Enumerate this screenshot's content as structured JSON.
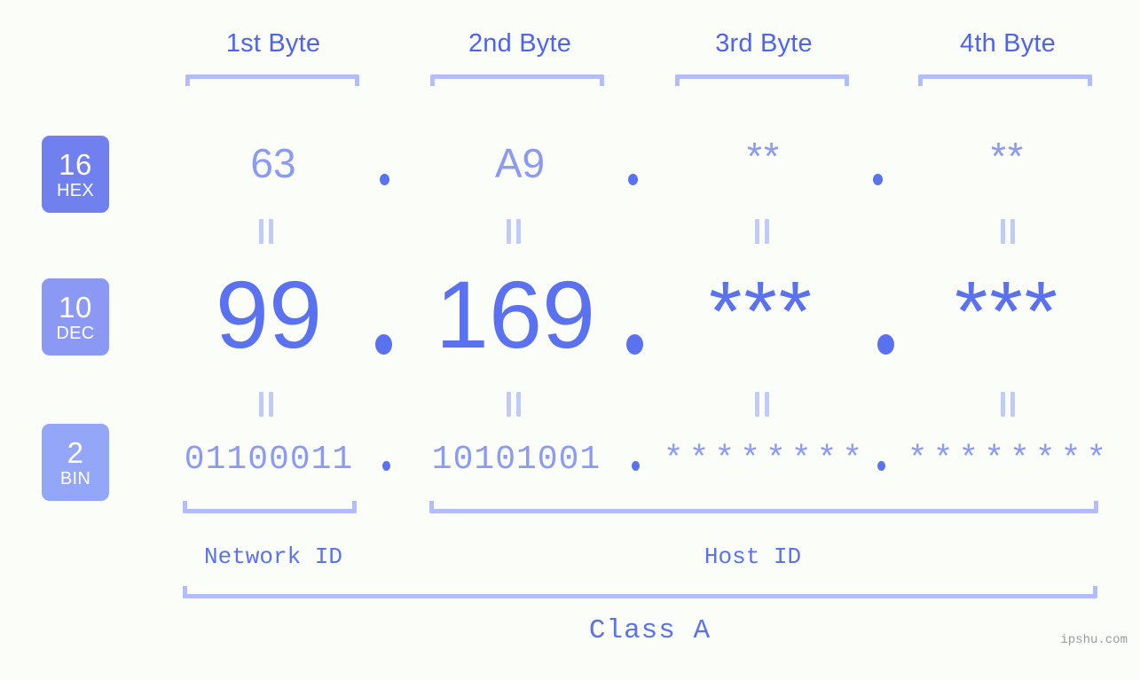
{
  "background_color": "#fbfdf9",
  "accent_color": "#5a72ef",
  "accent_light_color": "#8b9af2",
  "bracket_color": "#b4bdfb",
  "byte_headers": [
    {
      "label": "1st Byte"
    },
    {
      "label": "2nd Byte"
    },
    {
      "label": "3rd Byte"
    },
    {
      "label": "4th Byte"
    }
  ],
  "bases": [
    {
      "num": "16",
      "name": "HEX",
      "color": "#7081ef"
    },
    {
      "num": "10",
      "name": "DEC",
      "color": "#8b99f4"
    },
    {
      "num": "2",
      "name": "BIN",
      "color": "#94a6f7"
    }
  ],
  "rows": {
    "hex": {
      "base_num": "16",
      "base_name": "HEX",
      "values": [
        "63",
        "A9",
        "**",
        "**"
      ],
      "separator": "."
    },
    "dec": {
      "base_num": "10",
      "base_name": "DEC",
      "values": [
        "99",
        "169",
        "***",
        "***"
      ],
      "separator": "."
    },
    "bin": {
      "base_num": "2",
      "base_name": "BIN",
      "values": [
        "01100011",
        "10101001",
        "********",
        "********"
      ],
      "separator": "."
    }
  },
  "equals_glyph": "=",
  "id_labels": {
    "network": "Network ID",
    "host": "Host ID"
  },
  "class_label": "Class A",
  "watermark": "ipshu.com"
}
